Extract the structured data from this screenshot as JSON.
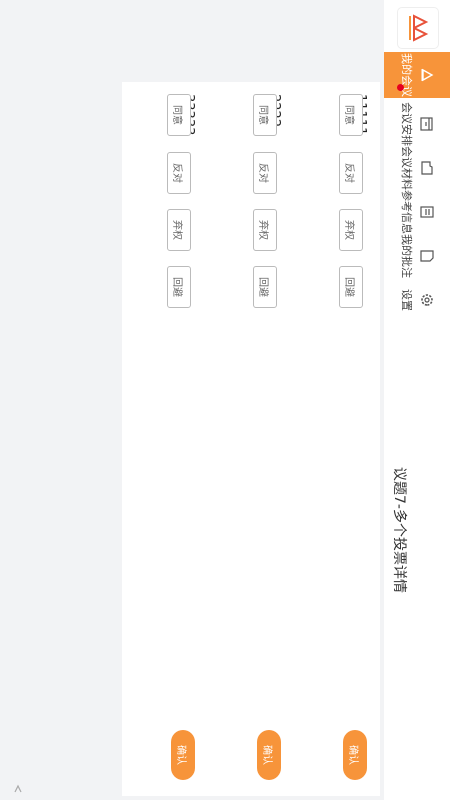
{
  "nav": {
    "items": [
      {
        "label": "我的会议",
        "icon": "meeting-room-icon",
        "active": true
      },
      {
        "label": "会议安排",
        "icon": "calendar-icon"
      },
      {
        "label": "会议材料",
        "icon": "folder-icon"
      },
      {
        "label": "参考信息",
        "icon": "document-icon"
      },
      {
        "label": "我的批注",
        "icon": "note-icon"
      },
      {
        "label": "设置",
        "icon": "gear-icon"
      }
    ]
  },
  "page": {
    "title": "议题7-多个投票详情"
  },
  "vote_items": [
    {
      "name": "11111",
      "options": [
        "同意",
        "反对",
        "弃权",
        "回避"
      ],
      "confirm": "确认"
    },
    {
      "name": "2222",
      "options": [
        "同意",
        "反对",
        "弃权",
        "回避"
      ],
      "confirm": "确认"
    },
    {
      "name": "33333",
      "options": [
        "同意",
        "反对",
        "弃权",
        "回避"
      ],
      "confirm": "确认"
    }
  ],
  "colors": {
    "accent": "#f7943a",
    "badge": "#e6001f",
    "background": "#f2f3f5"
  }
}
